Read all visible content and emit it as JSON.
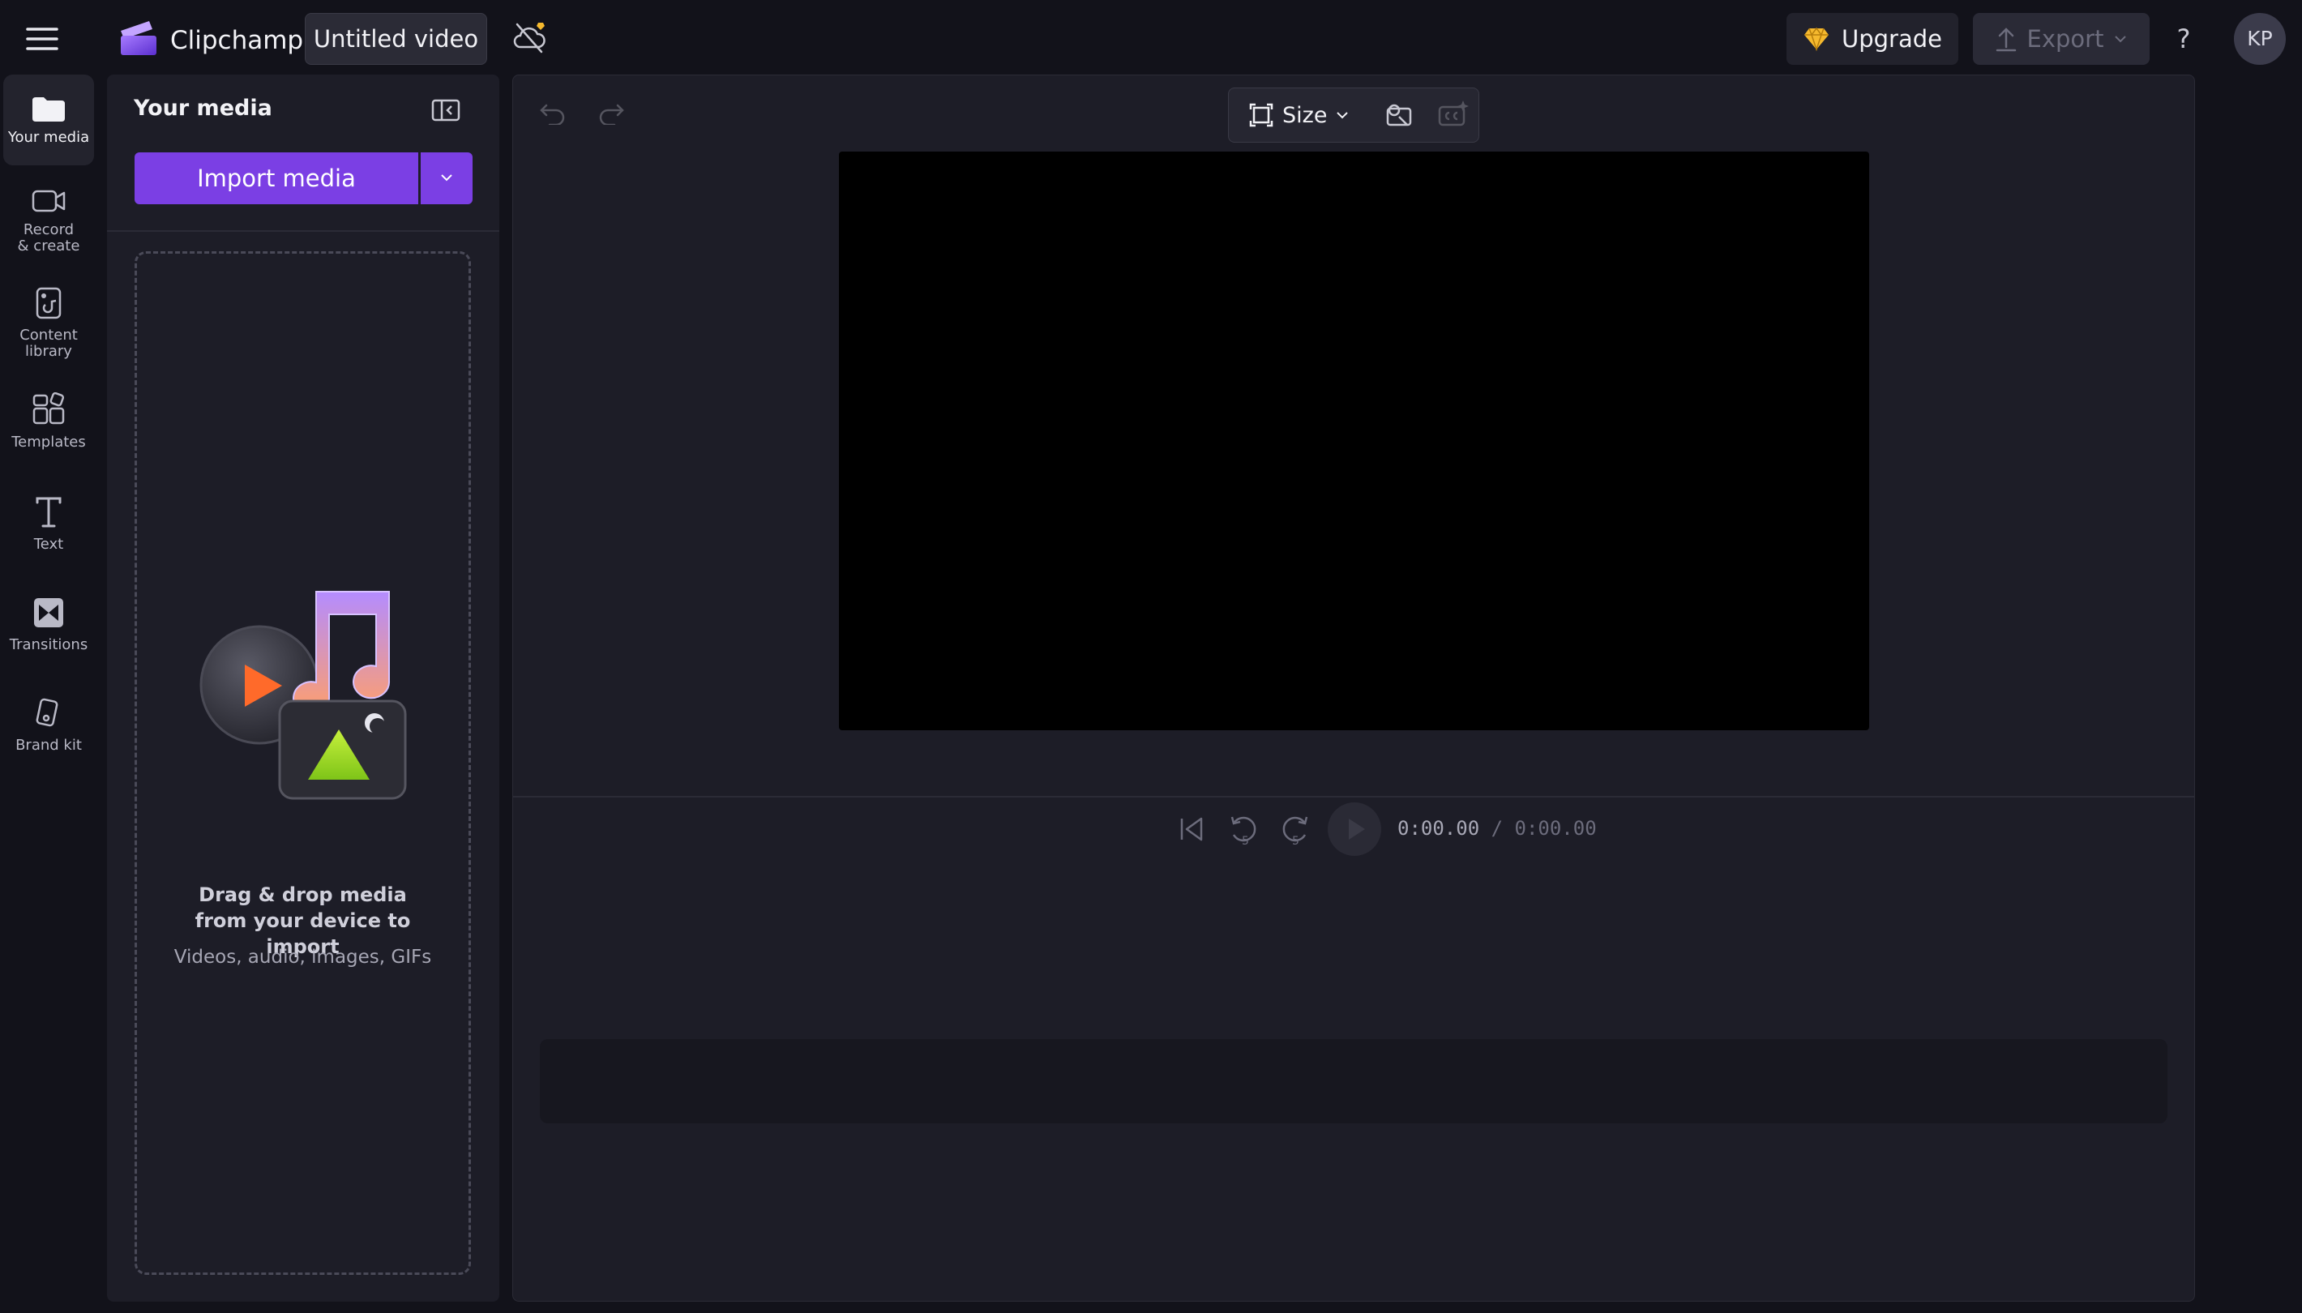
{
  "app": {
    "brand": "Clipchamp",
    "project_title": "Untitled video"
  },
  "header": {
    "upgrade_label": "Upgrade",
    "export_label": "Export",
    "help_label": "?",
    "avatar_initials": "KP"
  },
  "nav": {
    "items": [
      {
        "label": "Your media",
        "icon": "folder-icon"
      },
      {
        "label": "Record & create",
        "icon": "camera-icon"
      },
      {
        "label": "Content library",
        "icon": "content-library-icon"
      },
      {
        "label": "Templates",
        "icon": "templates-icon"
      },
      {
        "label": "Text",
        "icon": "text-icon"
      },
      {
        "label": "Transitions",
        "icon": "transitions-icon"
      },
      {
        "label": "Brand kit",
        "icon": "brand-kit-icon"
      }
    ]
  },
  "media_panel": {
    "title": "Your media",
    "import_label": "Import media",
    "drop_title": "Drag & drop media from your device to import",
    "drop_subtitle": "Videos, audio, images, GIFs"
  },
  "preview": {
    "size_label": "Size"
  },
  "playback": {
    "current_time": "0:00.00",
    "total_time": "/ 0:00.00"
  },
  "colors": {
    "accent": "#7b3fe4",
    "background": "#12121a",
    "panel": "#1d1d27",
    "upgrade_icon": "#f5b92e"
  }
}
